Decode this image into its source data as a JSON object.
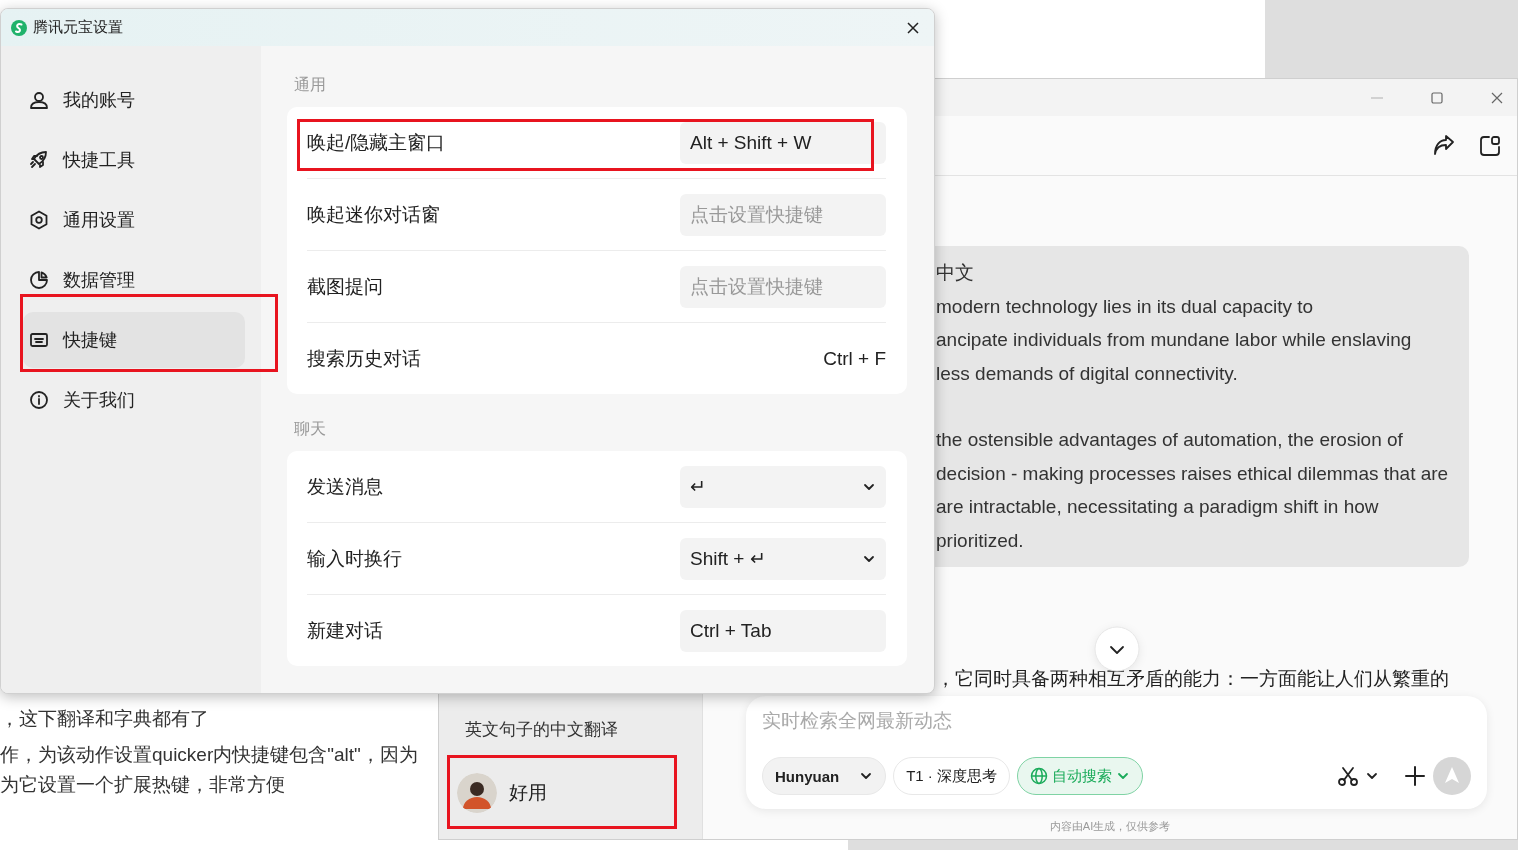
{
  "background_document": {
    "lines": [
      "，这下翻译和字典都有了",
      "作，为该动作设置quicker内快捷键包含\"alt\"，因为",
      "为它设置一个扩展热键，非常方便"
    ]
  },
  "app_window": {
    "conversation_list": {
      "items": [
        {
          "title": "英文句子的中文翻译"
        }
      ]
    },
    "profile": {
      "name": "好用",
      "highlighted": true
    },
    "answer_bubble": {
      "paragraphs": [
        [
          "中文",
          "modern technology lies in its dual capacity to",
          "ancipate individuals from mundane labor while enslaving",
          "less demands of digital connectivity."
        ],
        [
          "the ostensible advantages of automation, the erosion of",
          "decision - making processes raises ethical dilemmas that are",
          "are intractable, necessitating a paradigm shift in how",
          "prioritized."
        ]
      ]
    },
    "reply_line": "，它同时具备两种相互矛盾的能力：一方面能让人们从繁重的",
    "input": {
      "placeholder": "实时检索全网最新动态",
      "model": "Hunyuan",
      "mode": "T1 · 深度思考",
      "search": {
        "label": "自动搜索",
        "on": true
      }
    },
    "footer": "内容由AI生成，仅供参考"
  },
  "settings_window": {
    "title": "腾讯元宝设置",
    "sidebar": [
      {
        "label": "我的账号",
        "selected": false,
        "highlighted": false
      },
      {
        "label": "快捷工具",
        "selected": false,
        "highlighted": false
      },
      {
        "label": "通用设置",
        "selected": false,
        "highlighted": false
      },
      {
        "label": "数据管理",
        "selected": false,
        "highlighted": false
      },
      {
        "label": "快捷键",
        "selected": true,
        "highlighted": true
      },
      {
        "label": "关于我们",
        "selected": false,
        "highlighted": false
      }
    ],
    "sections": [
      {
        "title": "通用",
        "rows": [
          {
            "label": "唤起/隐藏主窗口",
            "kind": "field",
            "value": "Alt + Shift + W",
            "highlighted": true
          },
          {
            "label": "唤起迷你对话窗",
            "kind": "field",
            "placeholder": "点击设置快捷键",
            "highlighted": false
          },
          {
            "label": "截图提问",
            "kind": "field",
            "placeholder": "点击设置快捷键",
            "highlighted": false
          },
          {
            "label": "搜索历史对话",
            "kind": "text",
            "value": "Ctrl + F",
            "highlighted": false
          }
        ]
      },
      {
        "title": "聊天",
        "rows": [
          {
            "label": "发送消息",
            "kind": "select",
            "value": "↵",
            "highlighted": false
          },
          {
            "label": "输入时换行",
            "kind": "select",
            "value": "Shift + ↵",
            "highlighted": false
          },
          {
            "label": "新建对话",
            "kind": "field",
            "value": "Ctrl + Tab",
            "highlighted": false
          }
        ]
      }
    ]
  }
}
